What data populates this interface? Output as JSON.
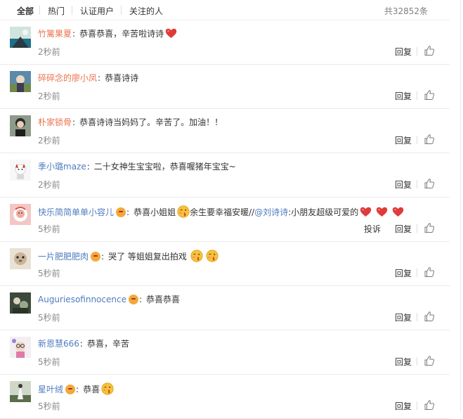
{
  "filter_tabs": [
    {
      "label": "全部",
      "active": true
    },
    {
      "label": "热门",
      "active": false
    },
    {
      "label": "认证用户",
      "active": false
    },
    {
      "label": "关注的人",
      "active": false
    }
  ],
  "total_count": "共32852条",
  "actions": {
    "reply": "回复",
    "report": "投诉"
  },
  "colors": {
    "username": "#eb7350",
    "link": "#4f7cbf",
    "heart": "#e03a3a",
    "vip_badge": "#f2a93b"
  },
  "comments": [
    {
      "username": "竹篱果夏",
      "text": "恭喜恭喜，辛苦啦诗诗",
      "emojis_after": [
        "heart-icon"
      ],
      "time": "2秒前"
    },
    {
      "username": "碎碎念的廖小凤",
      "text": "恭喜诗诗",
      "time": "2秒前"
    },
    {
      "username": "朴家锁骨",
      "text": "恭喜诗诗当妈妈了。辛苦了。加油！！",
      "time": "2秒前"
    },
    {
      "username": "季小璐maze",
      "text": "二十女神生宝宝啦，恭喜喔猪年宝宝~",
      "time": "2秒前"
    },
    {
      "username": "快乐简简单单小容儿",
      "vip": true,
      "text_a": "恭喜小姐姐",
      "text_b": "余生要幸福安暖//",
      "mention": "@刘诗诗",
      "text_c": ":小朋友超级可爱的",
      "emojis_after": [
        "heart-icon",
        "heart-icon",
        "heart-icon"
      ],
      "time": "5秒前",
      "report": true
    },
    {
      "username": "一片肥肥肥肉",
      "vip": true,
      "text": "哭了 等姐姐复出拍戏",
      "emojis_after": [
        "kiss-face-icon",
        "kiss-face-icon"
      ],
      "time": "5秒前"
    },
    {
      "username": "Auguriesofinnocence",
      "vip": true,
      "text": "恭喜恭喜",
      "time": "5秒前"
    },
    {
      "username": "新恩慧666",
      "text": "恭喜，辛苦",
      "time": "5秒前"
    },
    {
      "username": "星叶绒",
      "vip": true,
      "text": "恭喜",
      "emojis_after": [
        "kiss-face-icon"
      ],
      "time": "5秒前"
    }
  ]
}
